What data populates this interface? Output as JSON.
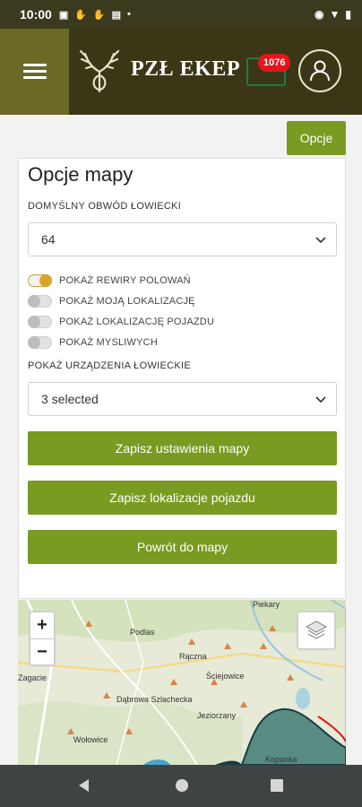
{
  "status_bar": {
    "time": "10:00"
  },
  "header": {
    "logo_text": "PZŁ EKEP",
    "notification_count": "1076"
  },
  "options_button": "Opcje",
  "panel": {
    "title": "Opcje mapy",
    "district_label": "DOMYŚLNY OBWÓD ŁOWIECKI",
    "district_value": "64",
    "toggles": [
      {
        "label": "POKAŻ REWIRY POLOWAŃ",
        "on": true
      },
      {
        "label": "POKAŻ MOJĄ LOKALIZACJĘ",
        "on": false
      },
      {
        "label": "POKAŻ LOKALIZACJĘ POJAZDU",
        "on": false
      },
      {
        "label": "POKAŻ MYSLIWYCH",
        "on": false
      }
    ],
    "devices_label": "POKAŻ URZĄDZENIA ŁOWIECKIE",
    "devices_value": "3 selected",
    "buttons": {
      "save_map": "Zapisz ustawienia mapy",
      "save_vehicle": "Zapisz lokalizacje pojazdu",
      "back": "Powrót do mapy"
    }
  },
  "map": {
    "zoom_in": "+",
    "zoom_out": "−",
    "places": [
      "Piekary",
      "Podlas",
      "Rączna",
      "Zagacie",
      "Ściejowice",
      "Dąbrowa Szlachecka",
      "Jeziorzany",
      "Wołowice",
      "Kopanka"
    ]
  },
  "colors": {
    "accent": "#7a9b22",
    "topbar": "#3b3716",
    "badge": "#e8141b"
  }
}
